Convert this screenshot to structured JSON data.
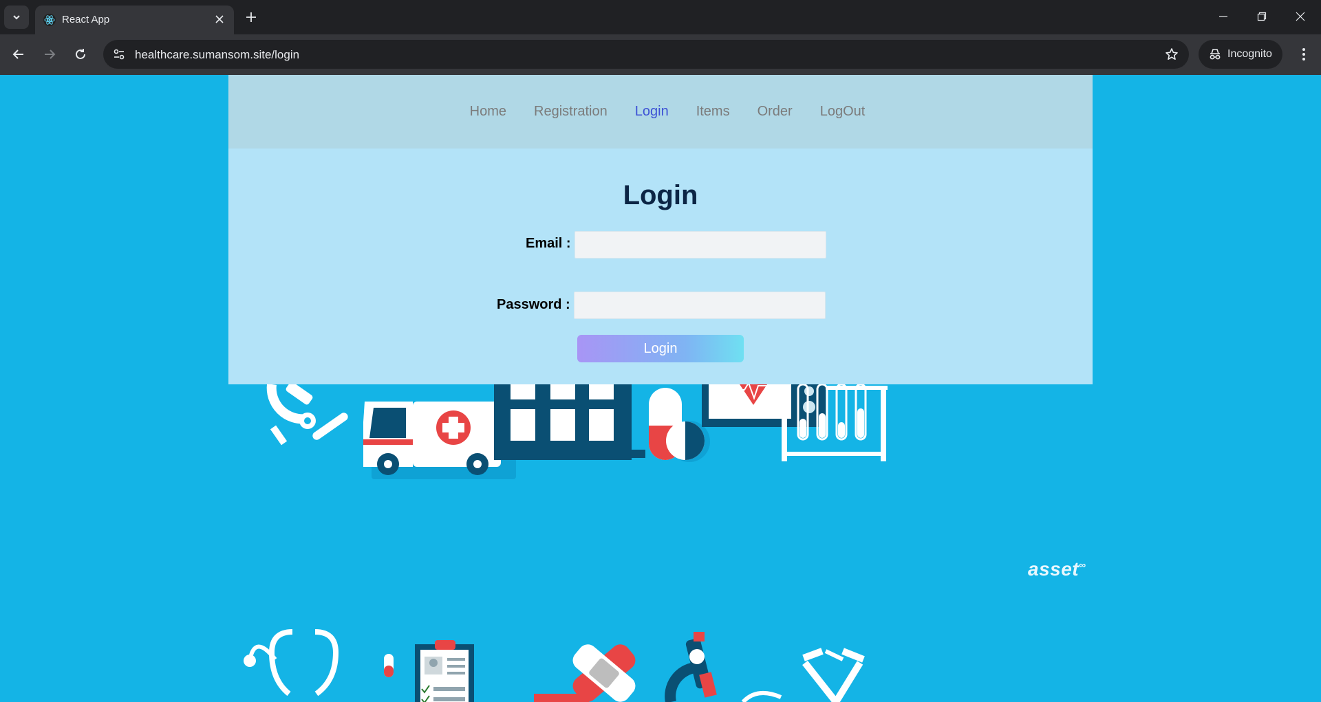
{
  "browser": {
    "tab_title": "React App",
    "url": "healthcare.sumansom.site/login",
    "incognito_label": "Incognito"
  },
  "nav": {
    "items": [
      {
        "label": "Home"
      },
      {
        "label": "Registration"
      },
      {
        "label": "Login"
      },
      {
        "label": "Items"
      },
      {
        "label": "Order"
      },
      {
        "label": "LogOut"
      }
    ],
    "active": "Login"
  },
  "login": {
    "title": "Login",
    "email_label": "Email :",
    "email_value": "",
    "password_label": "Password :",
    "password_value": "",
    "button_label": "Login"
  },
  "background": {
    "watermark": "asset",
    "watermark_mark": "∞"
  },
  "colors": {
    "page_bg": "#14b4e6",
    "navbar_bg": "#b0d8e6",
    "panel_bg": "#b3e3f8",
    "active_link": "#3d52d5",
    "title_color": "#0c2545"
  }
}
